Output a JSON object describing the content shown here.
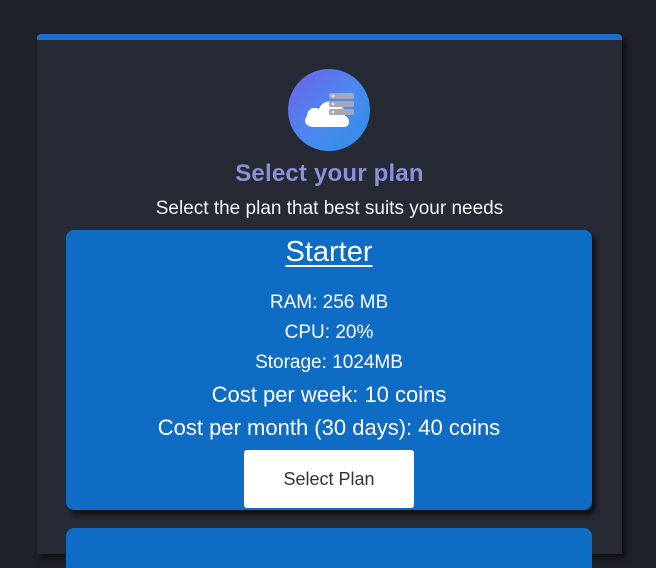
{
  "header": {
    "logo_icon": "cloud-server-icon",
    "title": "Select your plan",
    "subtitle": "Select the plan that best suits your needs"
  },
  "plans": [
    {
      "name": "Starter",
      "ram": "RAM: 256 MB",
      "cpu": "CPU: 20%",
      "storage": "Storage: 1024MB",
      "cost_week": "Cost per week: 10 coins",
      "cost_month": "Cost per month (30 days): 40 coins",
      "button_label": "Select Plan"
    }
  ],
  "colors": {
    "page_background": "#1f2128",
    "panel_background": "#252a35",
    "accent_blue": "#1f6fd0",
    "card_blue": "#0f6cc4",
    "title_color": "#8d8fd8"
  }
}
